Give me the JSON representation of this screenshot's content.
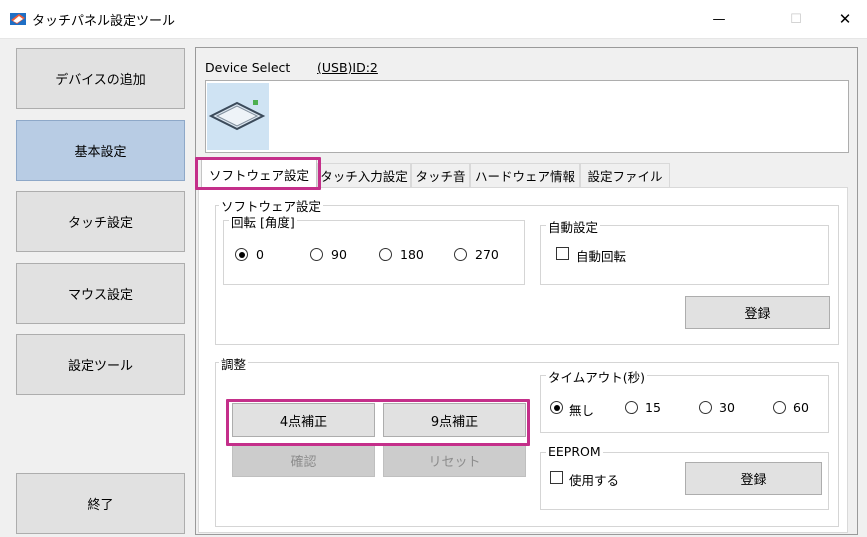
{
  "window": {
    "title": "タッチパネル設定ツール",
    "minimize": "—",
    "maximize": "☐",
    "close": "✕"
  },
  "nav": {
    "items": [
      {
        "label": "デバイスの追加"
      },
      {
        "label": "基本設定"
      },
      {
        "label": "タッチ設定"
      },
      {
        "label": "マウス設定"
      },
      {
        "label": "設定ツール"
      }
    ],
    "exit": "終了"
  },
  "device": {
    "select_label": "Device Select",
    "id": "(USB)ID:2"
  },
  "tabs": [
    "ソフトウェア設定",
    "タッチ入力設定",
    "タッチ音",
    "ハードウェア情報",
    "設定ファイル"
  ],
  "software": {
    "group_title": "ソフトウェア設定",
    "rotation": {
      "title": "回転 [角度]",
      "options": [
        "0",
        "90",
        "180",
        "270"
      ],
      "selected": "0"
    },
    "auto": {
      "title": "自動設定",
      "checkbox": "自動回転",
      "register": "登録"
    }
  },
  "adjust": {
    "title": "調整",
    "btn4": "4点補正",
    "btn9": "9点補正",
    "confirm": "確認",
    "reset": "リセット"
  },
  "timeout": {
    "title": "タイムアウト(秒)",
    "options": [
      "無し",
      "15",
      "30",
      "60"
    ],
    "selected": "無し"
  },
  "eeprom": {
    "title": "EEPROM",
    "checkbox": "使用する",
    "register": "登録"
  },
  "colors": {
    "highlight": "#c42f8a",
    "active_nav": "#b8cce4"
  }
}
